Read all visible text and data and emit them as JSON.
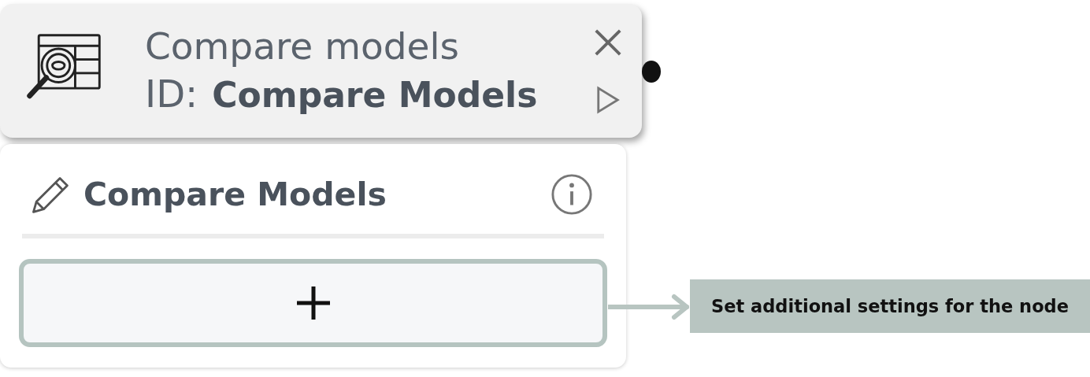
{
  "node": {
    "title": "Compare models",
    "id_label": "ID:",
    "id_value": "Compare Models"
  },
  "panel": {
    "title": "Compare Models"
  },
  "callout": {
    "text": "Set additional settings for the node"
  }
}
